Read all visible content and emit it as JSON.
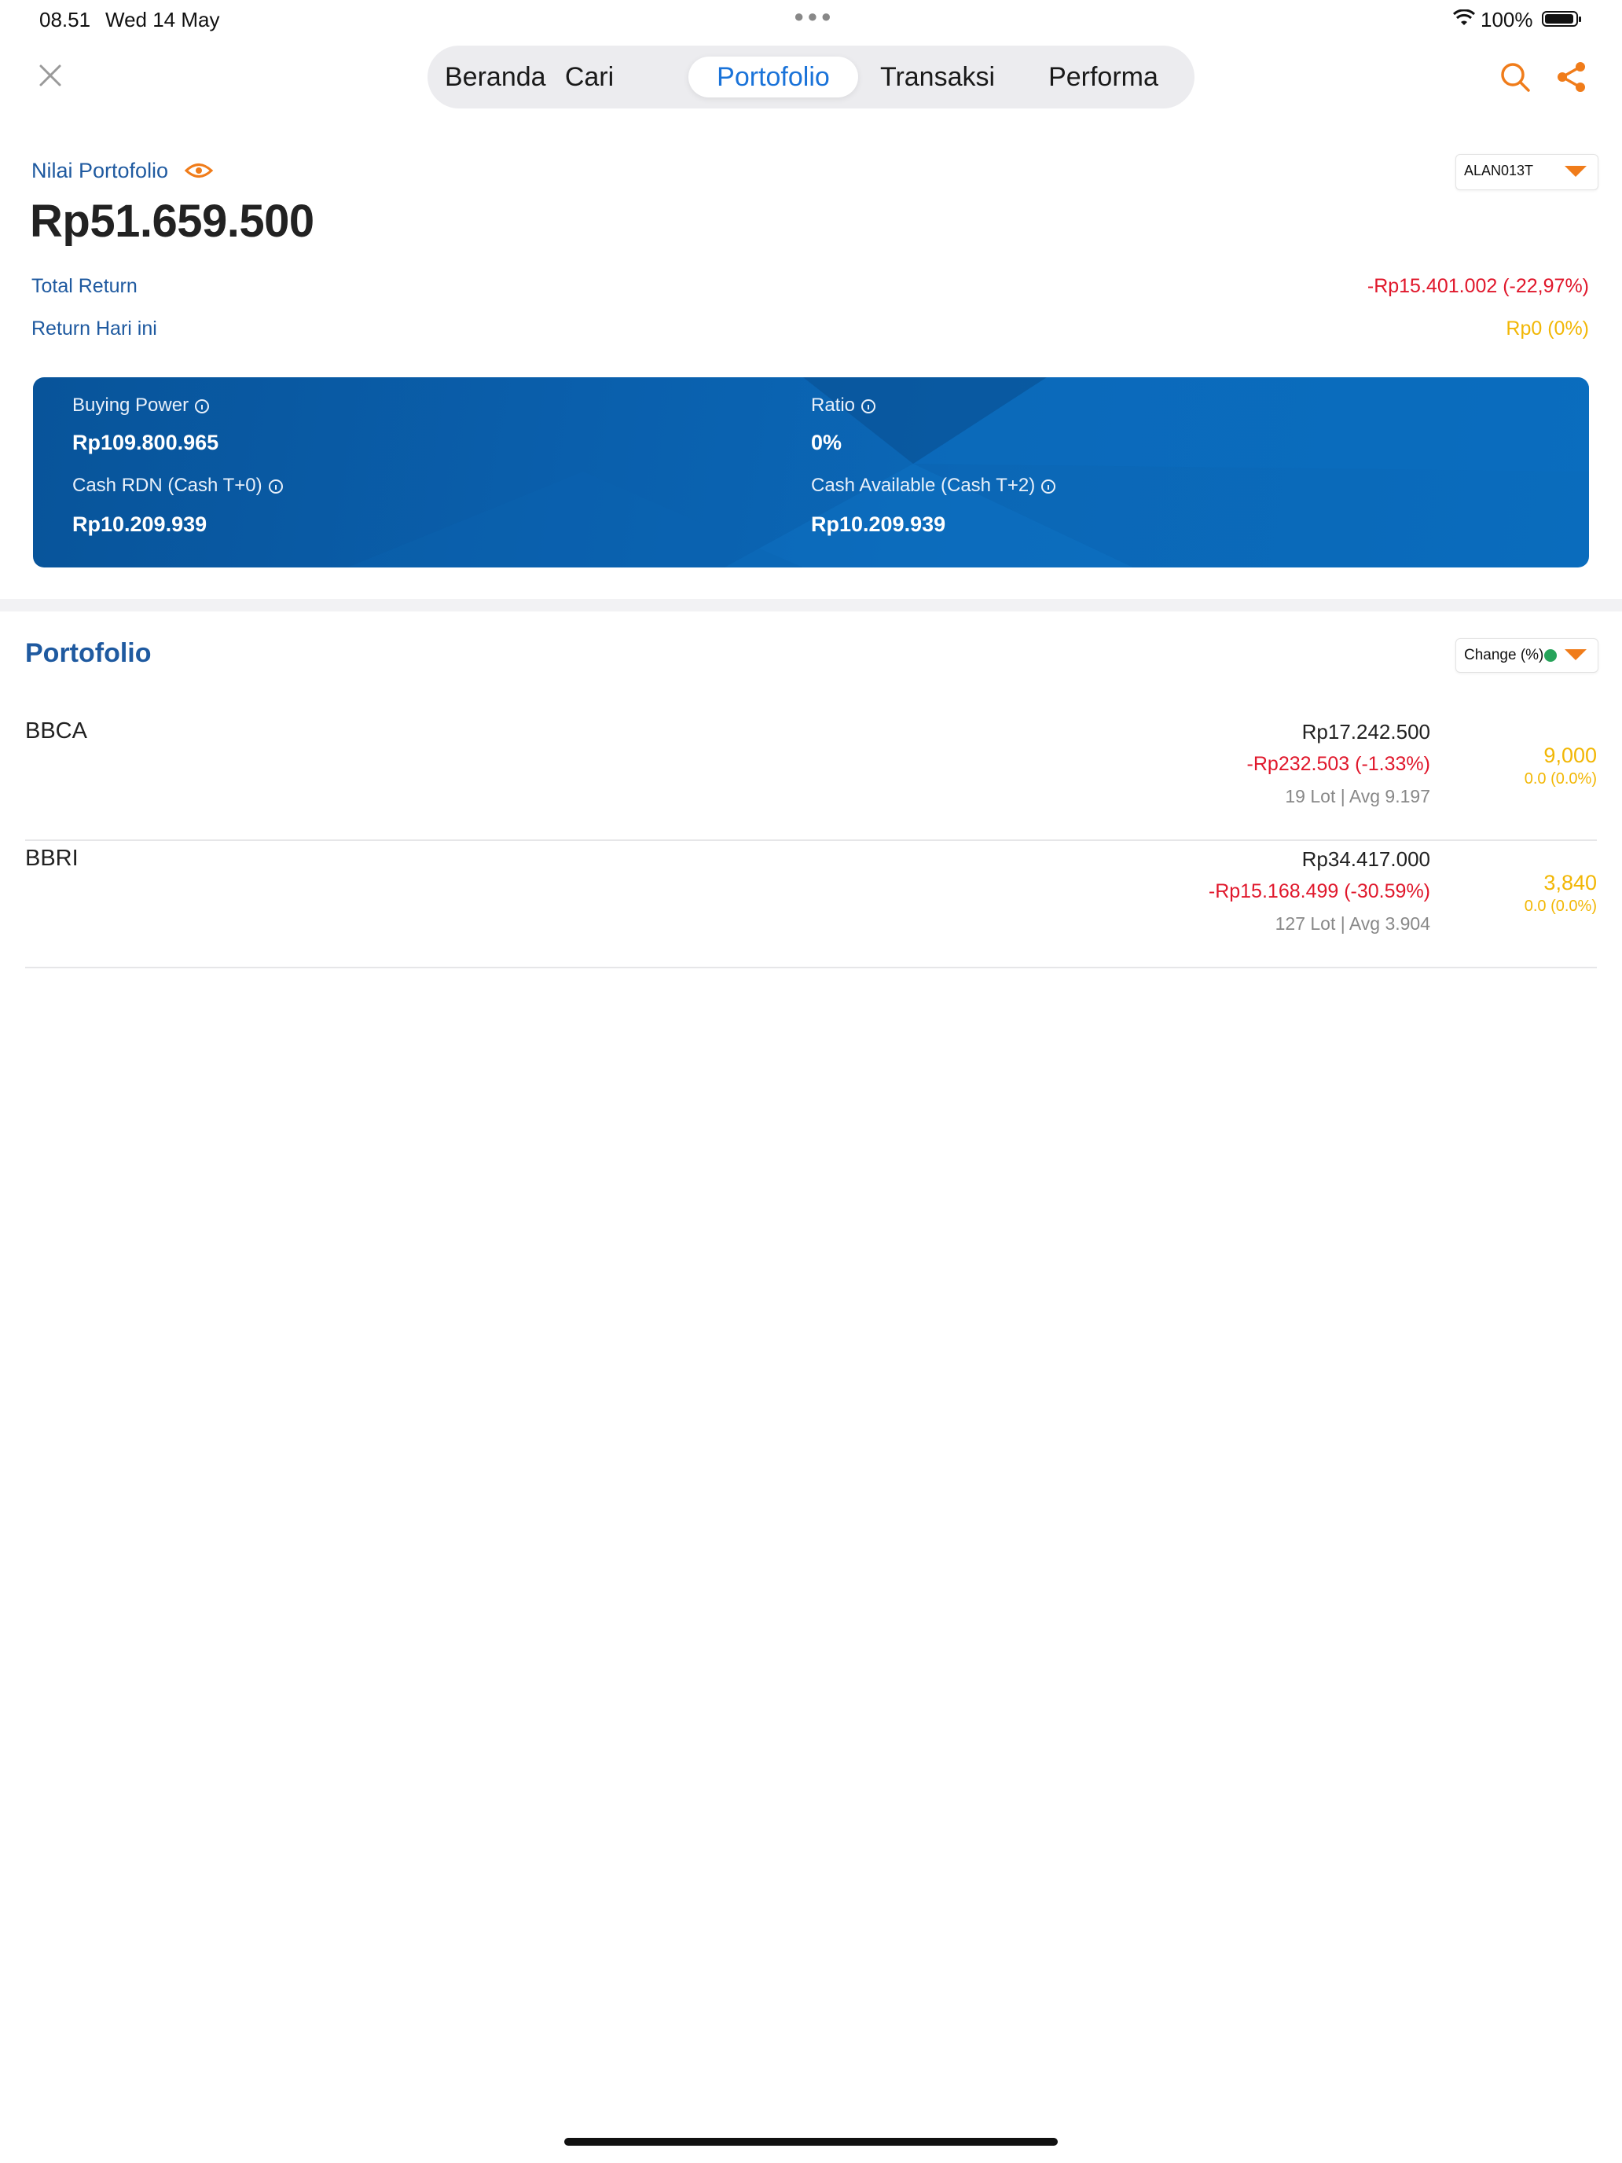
{
  "status_bar": {
    "time": "08.51",
    "date": "Wed 14 May",
    "battery": "100%"
  },
  "nav": {
    "tabs": [
      "Beranda",
      "Cari",
      "Portofolio",
      "Transaksi",
      "Performa"
    ],
    "active_tab": "Portofolio"
  },
  "summary": {
    "label": "Nilai Portofolio",
    "value": "Rp51.659.500",
    "account": "ALAN013T",
    "total_return_label": "Total Return",
    "total_return_value": "-Rp15.401.002 (-22,97%)",
    "today_return_label": "Return Hari ini",
    "today_return_value": "Rp0 (0%)"
  },
  "card": {
    "buying_power_label": "Buying Power",
    "buying_power_value": "Rp109.800.965",
    "ratio_label": "Ratio",
    "ratio_value": "0%",
    "cash_rdn_label": "Cash RDN (Cash T+0)",
    "cash_rdn_value": "Rp10.209.939",
    "cash_available_label": "Cash Available (Cash T+2)",
    "cash_available_value": "Rp10.209.939"
  },
  "portfolio": {
    "title": "Portofolio",
    "sort_label": "Change (%)",
    "items": [
      {
        "ticker": "BBCA",
        "market_value": "Rp17.242.500",
        "pl": "-Rp232.503 (-1.33%)",
        "lot_avg": "19 Lot | Avg 9.197",
        "price": "9,000",
        "change": "0.0 (0.0%)"
      },
      {
        "ticker": "BBRI",
        "market_value": "Rp34.417.000",
        "pl": "-Rp15.168.499 (-30.59%)",
        "lot_avg": "127 Lot | Avg 3.904",
        "price": "3,840",
        "change": "0.0 (0.0%)"
      }
    ]
  },
  "colors": {
    "accent_blue": "#1a73d9",
    "label_blue": "#1f5aa0",
    "negative": "#e0172b",
    "neutral": "#f2b705",
    "orange": "#f07c1a"
  }
}
